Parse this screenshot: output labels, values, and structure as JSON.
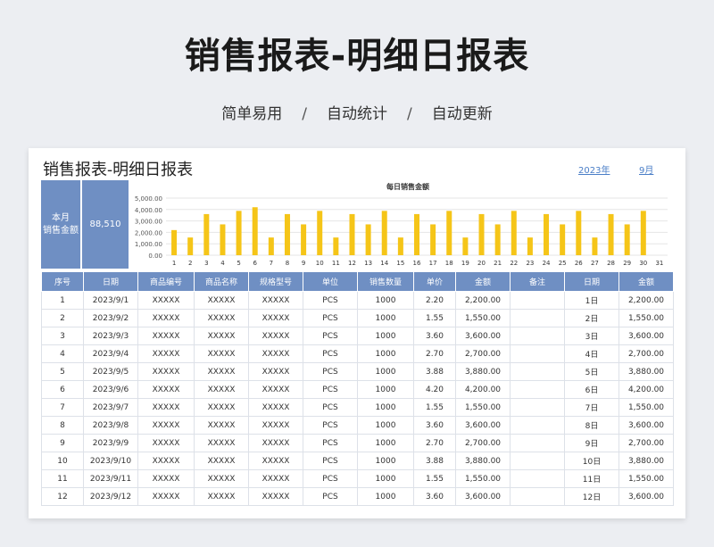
{
  "hero": {
    "title": "销售报表-明细日报表",
    "subtitle": [
      "简单易用",
      "自动统计",
      "自动更新"
    ],
    "separator": "/"
  },
  "sheet": {
    "title": "销售报表-明细日报表",
    "year": "2023年",
    "month": "9月"
  },
  "kpi": {
    "label_line1": "本月",
    "label_line2": "销售金额",
    "value": "88,510",
    "color": "#6f8fc3"
  },
  "chart_data": {
    "type": "bar",
    "title": "每日销售金额",
    "categories": [
      "1",
      "2",
      "3",
      "4",
      "5",
      "6",
      "7",
      "8",
      "9",
      "10",
      "11",
      "12",
      "13",
      "14",
      "15",
      "16",
      "17",
      "18",
      "19",
      "20",
      "21",
      "22",
      "23",
      "24",
      "25",
      "26",
      "27",
      "28",
      "29",
      "30",
      "31"
    ],
    "values": [
      2200,
      1550,
      3600,
      2700,
      3880,
      4200,
      1550,
      3600,
      2700,
      3880,
      1550,
      3600,
      2700,
      3880,
      1550,
      3600,
      2700,
      3880,
      1550,
      3600,
      2700,
      3880,
      1550,
      3600,
      2700,
      3880,
      1550,
      3600,
      2700,
      3880,
      0
    ],
    "yticks": [
      "5,000.00",
      "4,000.00",
      "3,000.00",
      "2,000.00",
      "1,000.00",
      "0.00"
    ],
    "ylim": [
      0,
      5000
    ],
    "bar_color": "#f5c518",
    "grid": true
  },
  "table": {
    "headers": [
      "序号",
      "日期",
      "商品编号",
      "商品名称",
      "规格型号",
      "单位",
      "销售数量",
      "单价",
      "金额",
      "备注"
    ],
    "rows": [
      [
        "1",
        "2023/9/1",
        "XXXXX",
        "XXXXX",
        "XXXXX",
        "PCS",
        "1000",
        "2.20",
        "2,200.00",
        ""
      ],
      [
        "2",
        "2023/9/2",
        "XXXXX",
        "XXXXX",
        "XXXXX",
        "PCS",
        "1000",
        "1.55",
        "1,550.00",
        ""
      ],
      [
        "3",
        "2023/9/3",
        "XXXXX",
        "XXXXX",
        "XXXXX",
        "PCS",
        "1000",
        "3.60",
        "3,600.00",
        ""
      ],
      [
        "4",
        "2023/9/4",
        "XXXXX",
        "XXXXX",
        "XXXXX",
        "PCS",
        "1000",
        "2.70",
        "2,700.00",
        ""
      ],
      [
        "5",
        "2023/9/5",
        "XXXXX",
        "XXXXX",
        "XXXXX",
        "PCS",
        "1000",
        "3.88",
        "3,880.00",
        ""
      ],
      [
        "6",
        "2023/9/6",
        "XXXXX",
        "XXXXX",
        "XXXXX",
        "PCS",
        "1000",
        "4.20",
        "4,200.00",
        ""
      ],
      [
        "7",
        "2023/9/7",
        "XXXXX",
        "XXXXX",
        "XXXXX",
        "PCS",
        "1000",
        "1.55",
        "1,550.00",
        ""
      ],
      [
        "8",
        "2023/9/8",
        "XXXXX",
        "XXXXX",
        "XXXXX",
        "PCS",
        "1000",
        "3.60",
        "3,600.00",
        ""
      ],
      [
        "9",
        "2023/9/9",
        "XXXXX",
        "XXXXX",
        "XXXXX",
        "PCS",
        "1000",
        "2.70",
        "2,700.00",
        ""
      ],
      [
        "10",
        "2023/9/10",
        "XXXXX",
        "XXXXX",
        "XXXXX",
        "PCS",
        "1000",
        "3.88",
        "3,880.00",
        ""
      ],
      [
        "11",
        "2023/9/11",
        "XXXXX",
        "XXXXX",
        "XXXXX",
        "PCS",
        "1000",
        "1.55",
        "1,550.00",
        ""
      ],
      [
        "12",
        "2023/9/12",
        "XXXXX",
        "XXXXX",
        "XXXXX",
        "PCS",
        "1000",
        "3.60",
        "3,600.00",
        ""
      ]
    ]
  },
  "side_table": {
    "headers": [
      "日期",
      "金额"
    ],
    "rows": [
      [
        "1日",
        "2,200.00"
      ],
      [
        "2日",
        "1,550.00"
      ],
      [
        "3日",
        "3,600.00"
      ],
      [
        "4日",
        "2,700.00"
      ],
      [
        "5日",
        "3,880.00"
      ],
      [
        "6日",
        "4,200.00"
      ],
      [
        "7日",
        "1,550.00"
      ],
      [
        "8日",
        "3,600.00"
      ],
      [
        "9日",
        "2,700.00"
      ],
      [
        "10日",
        "3,880.00"
      ],
      [
        "11日",
        "1,550.00"
      ],
      [
        "12日",
        "3,600.00"
      ]
    ]
  }
}
